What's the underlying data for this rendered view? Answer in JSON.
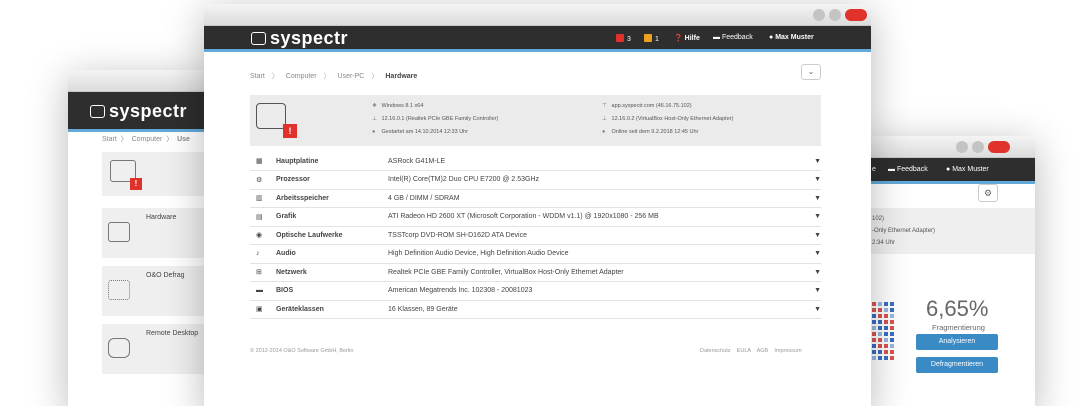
{
  "brand": {
    "logo": "syspectr"
  },
  "main": {
    "alerts": {
      "errors": "3",
      "warnings": "1"
    },
    "menu": {
      "help": "Hilfe",
      "feedback": "Feedback",
      "user": "Max Muster"
    },
    "breadcrumb": [
      "Start",
      "Computer",
      "User-PC",
      "Hardware"
    ],
    "info": {
      "os": "Windows 8.1 x64",
      "ip1": "12.16.0.1 (Realtek PCIe GBE Family Controller)",
      "started": "Gestartet am 14.10.2014 12:33 Uhr",
      "server": "app.syspectr.com (46.16.75.102)",
      "ip2": "12.16.0.2 (VirtualBox Host-Only Ethernet Adapter)",
      "online": "Online seit dem 9.2.2018 12:45 Uhr"
    },
    "hardware": [
      {
        "name": "Hauptplatine",
        "value": "ASRock G41M-LE"
      },
      {
        "name": "Prozessor",
        "value": "Intel(R) Core(TM)2 Duo CPU E7200 @ 2.53GHz"
      },
      {
        "name": "Arbeitsspeicher",
        "value": "4 GB / DIMM / SDRAM"
      },
      {
        "name": "Grafik",
        "value": "ATI Radeon HD 2600 XT (Microsoft Corporation - WDDM v1.1) @ 1920x1080 - 256 MB"
      },
      {
        "name": "Optische Laufwerke",
        "value": "TSSTcorp DVD-ROM SH-D162D ATA Device"
      },
      {
        "name": "Audio",
        "value": "High Definition Audio Device, High Definition Audio Device"
      },
      {
        "name": "Netzwerk",
        "value": "Realtek PCIe GBE Family Controller, VirtualBox Host-Only Ethernet Adapter"
      },
      {
        "name": "BIOS",
        "value": "American Megatrends Inc. 102308 - 20081023"
      },
      {
        "name": "Geräteklassen",
        "value": "16 Klassen, 89 Geräte"
      }
    ],
    "footer": {
      "copyright": "© 2012-2014 O&O Software GmbH, Berlin",
      "links": [
        "Datenschutz",
        "EULA",
        "AGB",
        "Impressum"
      ]
    }
  },
  "left": {
    "breadcrumb": [
      "Start",
      "Computer",
      "Use"
    ],
    "tiles": [
      "Hardware",
      "O&O Defrag",
      "Remote Desktop"
    ]
  },
  "right": {
    "menu": {
      "feedback": "Feedback",
      "user": "Max Muster",
      "cut": "e"
    },
    "info": [
      "102)",
      "-Only Ethernet Adapter)",
      "2:34 Uhr"
    ],
    "fragmentation": "6,65%",
    "fragmentation_label": "Fragmentierung",
    "analyze": "Analysieren",
    "defragment": "Defragmentieren"
  },
  "colors": {
    "accent": "#62a9d8",
    "error": "#e0322a",
    "warning": "#f0a020",
    "button": "#3a8ac6"
  }
}
